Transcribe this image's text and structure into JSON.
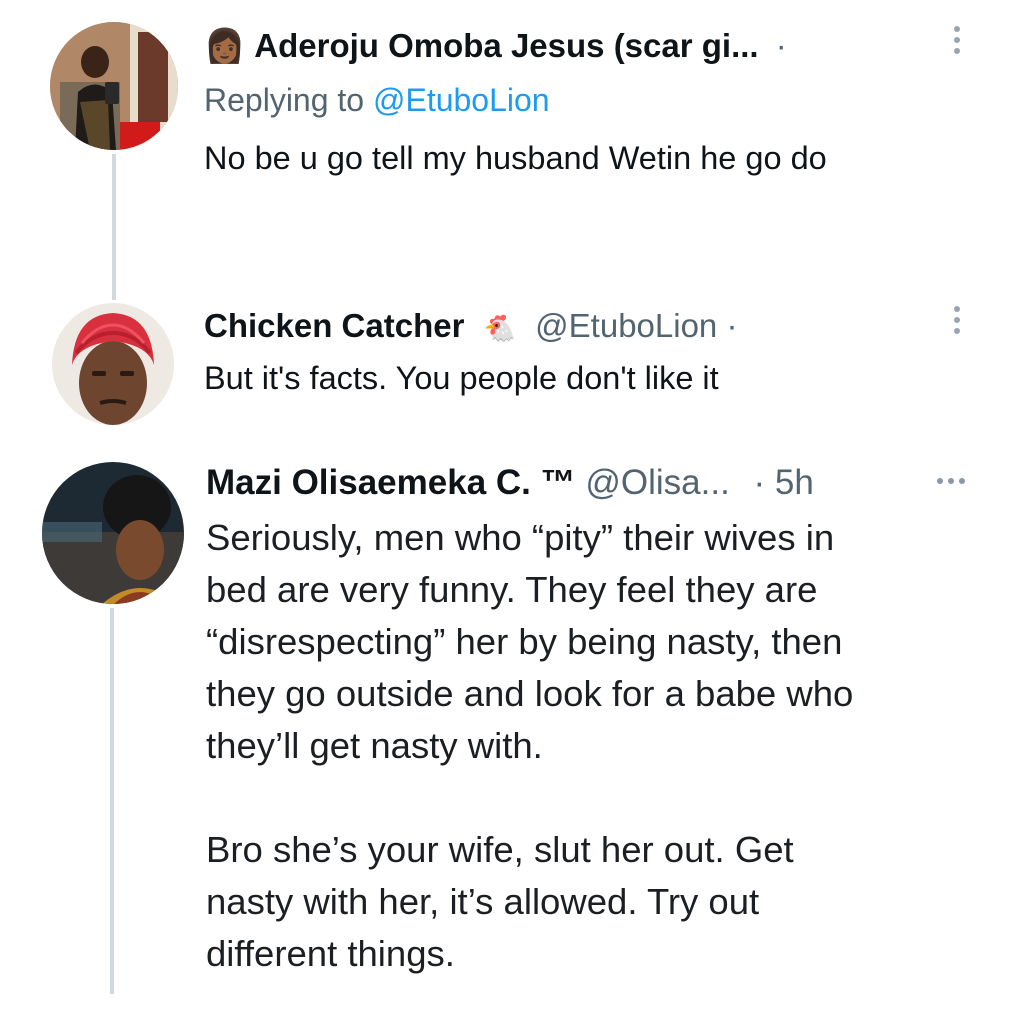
{
  "colors": {
    "link": "#1d9bf0",
    "muted": "#536471",
    "thread_line": "#cfd9de",
    "text": "#0f1419"
  },
  "tweets": [
    {
      "avatar_icon": "user-photo-icon",
      "name_emoji": "👩🏾",
      "name": "Aderoju Omoba Jesus (scar gi...",
      "separator": "·",
      "replying_prefix": "Replying to",
      "replying_handle": "@EtuboLion",
      "text": "No be u go tell my husband Wetin he go do",
      "menu_icon": "vertical-ellipsis-icon"
    },
    {
      "avatar_icon": "user-photo-icon",
      "name": "Chicken Catcher",
      "name_emoji": "🐔",
      "handle": "@EtuboLion",
      "separator": "·",
      "text": "But it's facts. You people don't like it",
      "menu_icon": "vertical-ellipsis-icon"
    },
    {
      "avatar_icon": "user-photo-icon",
      "name": "Mazi Olisaemeka C. ™",
      "handle": "@Olisa...",
      "time": "· 5h",
      "menu_icon": "horizontal-ellipsis-icon",
      "paragraph1": [
        "Seriously, men who “pity” their wives in",
        "bed are very funny. They feel they are",
        "“disrespecting” her by being nasty, then",
        "they go outside and look for a babe who",
        "they’ll get nasty with."
      ],
      "paragraph2": [
        "Bro she’s your wife, slut her out. Get",
        "nasty with her, it’s allowed. Try out",
        "different things."
      ]
    }
  ]
}
